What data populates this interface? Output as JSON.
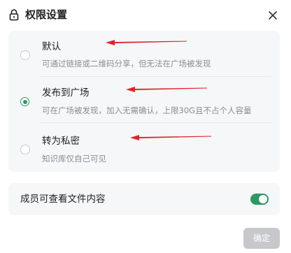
{
  "dialog": {
    "title": "权限设置",
    "icons": {
      "title_icon": "lock-icon",
      "close": "close-icon"
    }
  },
  "options": [
    {
      "label": "默认",
      "description": "可通过链接或二维码分享，但无法在广场被发现",
      "selected": false
    },
    {
      "label": "发布到广场",
      "description": "可在广场被发现，加入无需确认，上限30G且不占个人容量",
      "selected": true
    },
    {
      "label": "转为私密",
      "description": "知识库仅自己可见",
      "selected": false
    }
  ],
  "member_setting": {
    "label": "成员可查看文件内容",
    "enabled": true
  },
  "footer": {
    "confirm_label": "确定",
    "confirm_disabled": true
  },
  "colors": {
    "accent": "#2b9a62",
    "annotation_arrow": "#e0242a",
    "card_background": "#f6f7f8",
    "disabled_button": "#c6c8cb"
  },
  "annotations": {
    "arrow_count": 3,
    "arrow_icon": "red-arrow-pointing-left"
  }
}
